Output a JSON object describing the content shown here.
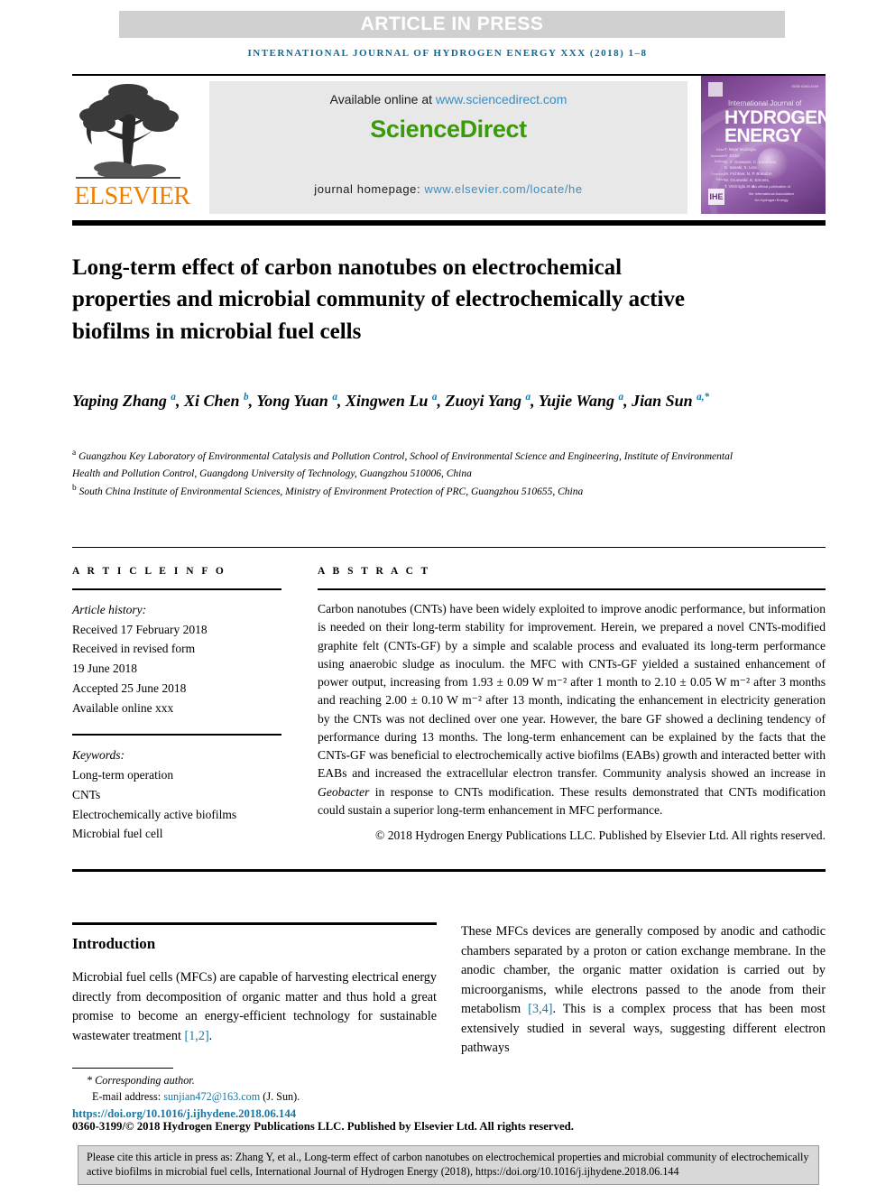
{
  "banner": {
    "label": "ARTICLE IN PRESS"
  },
  "running_head": "INTERNATIONAL JOURNAL OF HYDROGEN ENERGY XXX (2018) 1–8",
  "masthead": {
    "publisher_logo_label": "ELSEVIER",
    "available_prefix": "Available online at ",
    "available_link": "www.sciencedirect.com",
    "sciencedirect_label": "ScienceDirect",
    "homepage_prefix": "journal homepage: ",
    "homepage_link": "www.elsevier.com/locate/he",
    "cover": {
      "kicker": "International Journal of",
      "title_line1": "HYDROGEN",
      "title_line2": "ENERGY",
      "labels": "Editor\nAssociate Editors\n\nFounding Editor",
      "names": "T. Nejat Veziroglu\nA. Dicks\nD. Y. Goswami, C. Koroneos,\nK. Sasaki, S. Linic,\nM. Fichtner, N. P. Brandon\nM. Grunwald, B. Emonts,\nT. Veziroglu et al.",
      "ihe_mark": "IHE",
      "footer": "An official publication of\nthe International Association\nfor Hydrogen Energy",
      "top_right_code": "ISSN 0360-3199"
    }
  },
  "article": {
    "title": "Long-term effect of carbon nanotubes on electrochemical properties and microbial community of electrochemically active biofilms in microbial fuel cells",
    "authors": [
      {
        "name": "Yaping Zhang",
        "marks": "a"
      },
      {
        "name": "Xi Chen",
        "marks": "b"
      },
      {
        "name": "Yong Yuan",
        "marks": "a"
      },
      {
        "name": "Xingwen Lu",
        "marks": "a"
      },
      {
        "name": "Zuoyi Yang",
        "marks": "a"
      },
      {
        "name": "Yujie Wang",
        "marks": "a"
      },
      {
        "name": "Jian Sun",
        "marks": "a,*"
      }
    ],
    "affiliations": [
      {
        "mark": "a",
        "text": "Guangzhou Key Laboratory of Environmental Catalysis and Pollution Control, School of Environmental Science and Engineering, Institute of Environmental Health and Pollution Control, Guangdong University of Technology, Guangzhou 510006, China"
      },
      {
        "mark": "b",
        "text": "South China Institute of Environmental Sciences, Ministry of Environment Protection of PRC, Guangzhou 510655, China"
      }
    ]
  },
  "info": {
    "heading": "A R T I C L E  I N F O",
    "history_label": "Article history:",
    "history": [
      "Received 17 February 2018",
      "Received in revised form",
      "19 June 2018",
      "Accepted 25 June 2018",
      "Available online xxx"
    ],
    "keywords_label": "Keywords:",
    "keywords": [
      "Long-term operation",
      "CNTs",
      "Electrochemically active biofilms",
      "Microbial fuel cell"
    ]
  },
  "abstract": {
    "heading": "A B S T R A C T",
    "part1": "Carbon nanotubes (CNTs) have been widely exploited to improve anodic performance, but information is needed on their long-term stability for improvement. Herein, we prepared a novel CNTs-modified graphite felt (CNTs-GF) by a simple and scalable process and evaluated its long-term performance using anaerobic sludge as inoculum. the MFC with CNTs-GF yielded a sustained enhancement of power output, increasing from 1.93 ± 0.09 W m⁻² after 1 month to 2.10 ± 0.05 W m⁻² after 3 months and reaching 2.00 ± 0.10 W m⁻² after 13 month, indicating the enhancement in electricity generation by the CNTs was not declined over one year. However, the bare GF showed a declining tendency of performance during 13 months. The long-term enhancement can be explained by the facts that the CNTs-GF was beneficial to electrochemically active biofilms (EABs) growth and interacted better with EABs and increased the extracellular electron transfer. Community analysis showed an increase in ",
    "italic_term": "Geobacter",
    "part2": " in response to CNTs modification. These results demonstrated that CNTs modification could sustain a superior long-term enhancement in MFC performance.",
    "copyright": "© 2018 Hydrogen Energy Publications LLC. Published by Elsevier Ltd. All rights reserved."
  },
  "body": {
    "intro_heading": "Introduction",
    "left_paragraph_pre": "Microbial fuel cells (MFCs) are capable of harvesting electrical energy directly from decomposition of organic matter and thus hold a great promise to become an energy-efficient technology for sustainable wastewater treatment ",
    "left_ref": "[1,2]",
    "left_paragraph_post": ".",
    "right_paragraph_pre": "These MFCs devices are generally composed by anodic and cathodic chambers separated by a proton or cation exchange membrane. In the anodic chamber, the organic matter oxidation is carried out by microorganisms, while electrons passed to the anode from their metabolism ",
    "right_ref": "[3,4]",
    "right_paragraph_post": ". This is a complex process that has been most extensively studied in several ways, suggesting different electron pathways"
  },
  "footer": {
    "corresponding_mark": "*",
    "corresponding_label": "Corresponding author.",
    "email_label": "E-mail address: ",
    "email": "sunjian472@163.com",
    "email_suffix": " (J. Sun).",
    "doi": "https://doi.org/10.1016/j.ijhydene.2018.06.144",
    "issn_line": "0360-3199/© 2018 Hydrogen Energy Publications LLC. Published by Elsevier Ltd. All rights reserved.",
    "cite_text": "Please cite this article in press as: Zhang Y, et al., Long-term effect of carbon nanotubes on electrochemical properties and microbial community of electrochemically active biofilms in microbial fuel cells, International Journal of Hydrogen Energy (2018), https://doi.org/10.1016/j.ijhydene.2018.06.144"
  },
  "colors": {
    "link_blue": "#1577a8",
    "sciencedirect_green": "#3a9a0a",
    "elsevier_orange": "#f08000",
    "banner_gray": "#d0d0d0"
  }
}
